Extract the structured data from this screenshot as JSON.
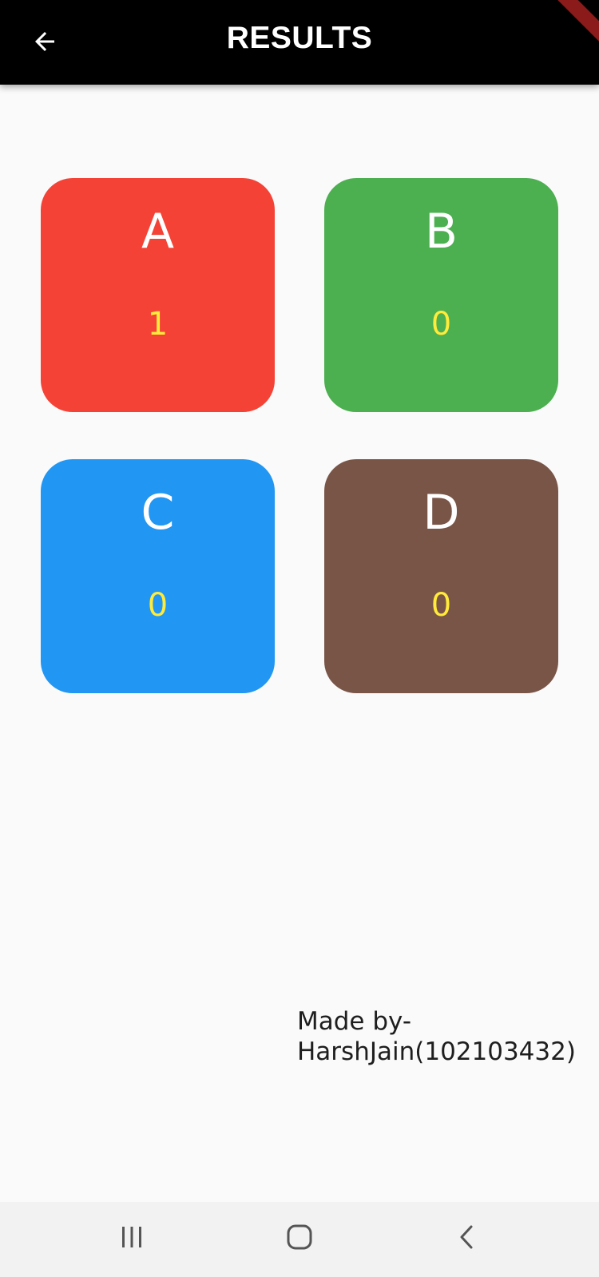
{
  "app_bar": {
    "title": "RESULTS",
    "back_icon": "arrow-left-icon",
    "background": "#000000"
  },
  "cards": [
    {
      "label": "A",
      "count": "1",
      "color": "#f44336"
    },
    {
      "label": "B",
      "count": "0",
      "color": "#4caf50"
    },
    {
      "label": "C",
      "count": "0",
      "color": "#2196f3"
    },
    {
      "label": "D",
      "count": "0",
      "color": "#795548"
    }
  ],
  "count_color": "#ffeb3b",
  "credit": {
    "line1": "Made by-",
    "line2": "HarshJain(102103432)"
  },
  "nav_bar": {
    "recent_icon": "recent-apps-icon",
    "home_icon": "home-icon",
    "back_icon": "back-chevron-icon"
  }
}
